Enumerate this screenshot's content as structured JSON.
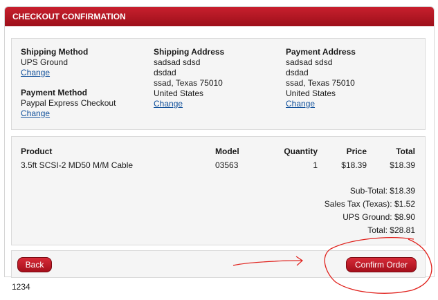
{
  "header": {
    "title": "CHECKOUT CONFIRMATION"
  },
  "shipping_method": {
    "heading": "Shipping Method",
    "value": "UPS Ground",
    "change": "Change"
  },
  "payment_method": {
    "heading": "Payment Method",
    "value": "Paypal Express Checkout",
    "change": "Change"
  },
  "shipping_address": {
    "heading": "Shipping Address",
    "lines": [
      "sadsad sdsd",
      "dsdad",
      "ssad, Texas 75010",
      "United States"
    ],
    "change": "Change"
  },
  "payment_address": {
    "heading": "Payment Address",
    "lines": [
      "sadsad sdsd",
      "dsdad",
      "ssad, Texas 75010",
      "United States"
    ],
    "change": "Change"
  },
  "products": {
    "columns": {
      "product": "Product",
      "model": "Model",
      "quantity": "Quantity",
      "price": "Price",
      "total": "Total"
    },
    "rows": [
      {
        "product": "3.5ft SCSI-2 MD50 M/M Cable",
        "model": "03563",
        "quantity": "1",
        "price": "$18.39",
        "total": "$18.39"
      }
    ]
  },
  "totals": [
    {
      "label": "Sub-Total:",
      "value": "$18.39"
    },
    {
      "label": "Sales Tax (Texas):",
      "value": "$1.52"
    },
    {
      "label": "UPS Ground:",
      "value": "$8.90"
    },
    {
      "label": "Total:",
      "value": "$28.81"
    }
  ],
  "actions": {
    "back": "Back",
    "confirm": "Confirm Order"
  },
  "footer": {
    "text": "1234"
  },
  "colors": {
    "accent": "#b01522",
    "link": "#0f4f9a",
    "annotation": "#e0201b"
  }
}
